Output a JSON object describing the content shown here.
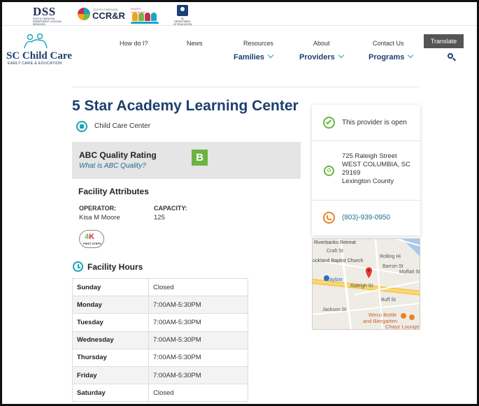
{
  "partner_logos": {
    "dss": {
      "big": "DSS",
      "small": "SOUTH CAROLINA DEPARTMENT of SOCIAL SERVICES"
    },
    "ccrr": {
      "big": "CCR&R",
      "small": "SOUTH CAROLINA"
    },
    "kids": {
      "small": "SOUTH CAROLINA"
    },
    "sc": {
      "small": "SC DEPARTMENT OF EDUCATION"
    }
  },
  "brand": {
    "name": "SC Child Care",
    "sub": "EARLY CARE & EDUCATION"
  },
  "top_nav": [
    "How do I?",
    "News",
    "Resources",
    "About",
    "Contact Us"
  ],
  "translate_label": "Translate",
  "main_nav": [
    "Families",
    "Providers",
    "Programs"
  ],
  "provider": {
    "name": "5 Star Academy Learning Center",
    "type": "Child Care Center",
    "rating_label": "ABC Quality Rating",
    "rating_link": "What is ABC Quality?",
    "rating": "B",
    "attributes_heading": "Facility Attributes",
    "operator_label": "OPERATOR:",
    "operator": "Kisa M Moore",
    "capacity_label": "CAPACITY:",
    "capacity": "125",
    "first_steps": {
      "big_a": "4",
      "big_b": "K",
      "small": "FIRST STEPS"
    },
    "hours_heading": "Facility Hours",
    "hours": [
      {
        "day": "Sunday",
        "time": "Closed"
      },
      {
        "day": "Monday",
        "time": "7:00AM-5:30PM"
      },
      {
        "day": "Tuesday",
        "time": "7:00AM-5:30PM"
      },
      {
        "day": "Wednesday",
        "time": "7:00AM-5:30PM"
      },
      {
        "day": "Thursday",
        "time": "7:00AM-5:30PM"
      },
      {
        "day": "Friday",
        "time": "7:00AM-5:30PM"
      },
      {
        "day": "Saturday",
        "time": "Closed"
      }
    ]
  },
  "card": {
    "status": "This provider is open",
    "address": [
      "725 Raleigh Street",
      "WEST COLUMBIA, SC",
      "29169",
      "Lexington County"
    ],
    "phone": "(803)-939-0950"
  },
  "map": {
    "labels": [
      "Riverbanks Retreat",
      "Craft St",
      "ookland Baptist Church",
      "Rolling Hi",
      "Barron St",
      "Moffatt St",
      "Graybar",
      "Raleigh St",
      "Buff St",
      "Jackson St",
      "Weco Bottle",
      "and Biergarten",
      "Chayz Lounge"
    ]
  },
  "colors": {
    "navy": "#1c3f6e",
    "teal": "#16a5b8",
    "green": "#6cb342",
    "orange": "#e8832a",
    "map_pin": "#e53935"
  }
}
